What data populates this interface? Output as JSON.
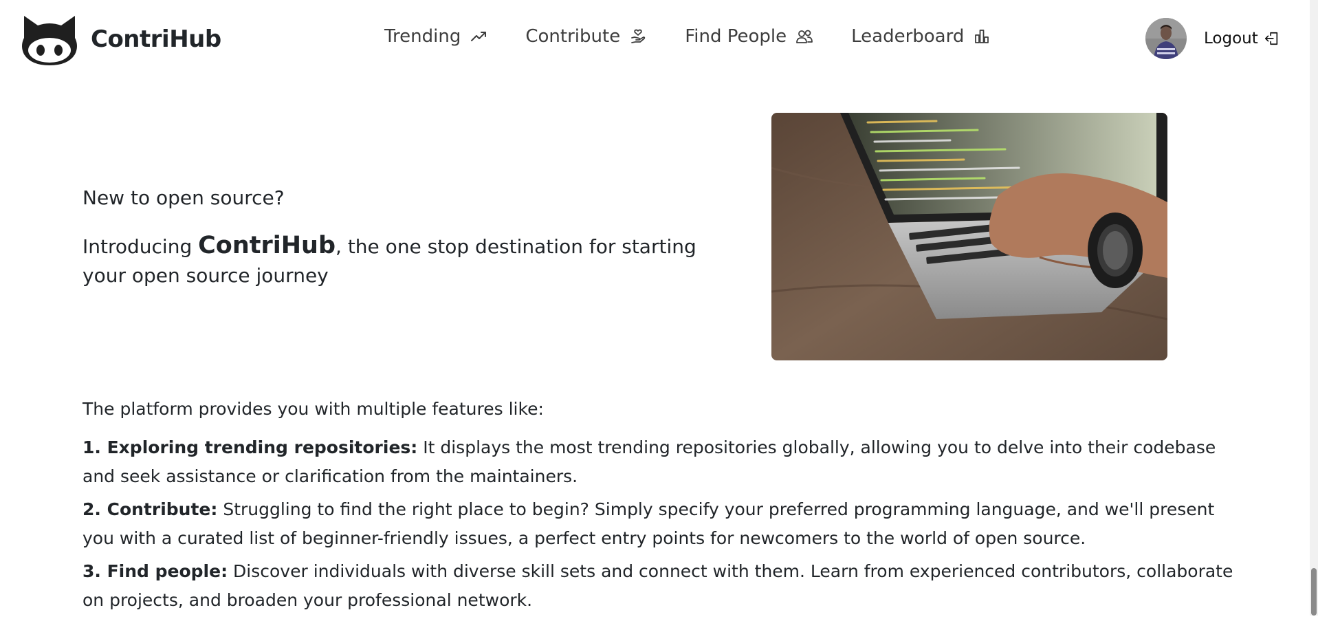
{
  "app": {
    "brand_name": "ContriHub"
  },
  "nav": {
    "items": [
      {
        "label": "Trending",
        "icon": "trending-up-icon"
      },
      {
        "label": "Contribute",
        "icon": "hand-heart-icon"
      },
      {
        "label": "Find People",
        "icon": "people-icon"
      },
      {
        "label": "Leaderboard",
        "icon": "bar-chart-icon"
      }
    ],
    "logout_label": "Logout",
    "logout_icon": "logout-icon"
  },
  "hero": {
    "question": "New to open source?",
    "intro_prefix": "Introducing ",
    "intro_brand": "ContriHub",
    "intro_suffix": ", the one stop destination for starting your open source journey",
    "image": "laptop-coding-photo"
  },
  "features": {
    "intro": "The platform provides you with multiple features like:",
    "items": [
      {
        "title": "1. Exploring trending repositories:",
        "text": " It displays the most trending repositories globally, allowing you to delve into their codebase and seek assistance or clarification from the maintainers."
      },
      {
        "title": "2. Contribute:",
        "text": " Struggling to find the right place to begin? Simply specify your preferred programming language, and we'll present you with a curated list of beginner-friendly issues, a perfect entry points for newcomers to the world of open source."
      },
      {
        "title": "3. Find people:",
        "text": " Discover individuals with diverse skill sets and connect with them. Learn from experienced contributors, collaborate on projects, and broaden your professional network."
      }
    ]
  },
  "colors": {
    "text": "#212529",
    "nav_text": "#3d3d3d",
    "background": "#ffffff"
  }
}
